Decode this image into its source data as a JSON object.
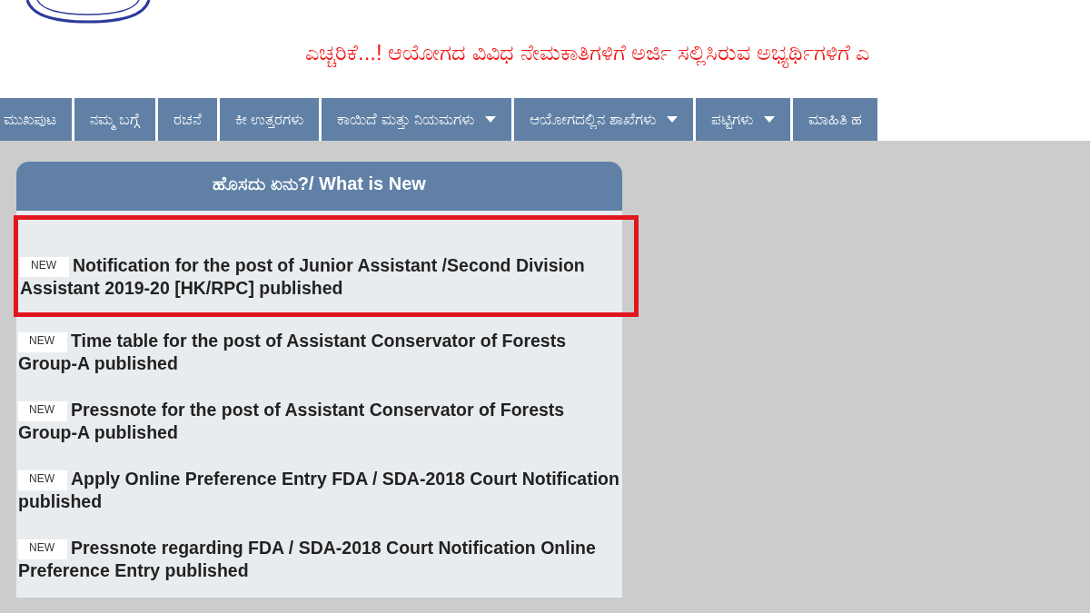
{
  "header": {
    "warning": "ಎಚ್ಚರಿಕೆ...! ಆಯೋಗದ ವಿವಿಧ ನೇಮಕಾತಿಗಳಿಗೆ ಅರ್ಜಿ ಸಲ್ಲಿಸಿರುವ ಅಭ್ಯರ್ಥಿಗಳಿಗೆ ಎ"
  },
  "nav": [
    {
      "label": "ಮುಖಪುಟ",
      "dropdown": false
    },
    {
      "label": "ನಮ್ಮ ಬಗ್ಗೆ",
      "dropdown": false
    },
    {
      "label": "ರಚನೆ",
      "dropdown": false
    },
    {
      "label": "ಕೀ ಉತ್ತರಗಳು",
      "dropdown": false
    },
    {
      "label": "ಕಾಯಿದೆ ಮತ್ತು ನಿಯಮಗಳು",
      "dropdown": true
    },
    {
      "label": "ಆಯೋಗದಲ್ಲಿನ ಶಾಖೆಗಳು",
      "dropdown": true
    },
    {
      "label": "ಪಟ್ಟಿಗಳು",
      "dropdown": true
    },
    {
      "label": "ಮಾಹಿತಿ ಹ",
      "dropdown": false
    }
  ],
  "news_panel": {
    "title": "ಹೊಸದು ಏನು?/ What is New",
    "items": [
      {
        "badge": "NEW",
        "text": "Notification for the post of Junior Assistant /Second Division Assistant 2019-20 [HK/RPC] published",
        "highlighted": true
      },
      {
        "badge": "NEW",
        "text": "Time table for the post of Assistant Conservator of Forests Group-A published",
        "highlighted": false
      },
      {
        "badge": "NEW",
        "text": "Pressnote for the post of Assistant Conservator of Forests Group-A published",
        "highlighted": false
      },
      {
        "badge": "NEW",
        "text": "Apply Online Preference Entry FDA / SDA-2018 Court Notification published",
        "highlighted": false
      },
      {
        "badge": "NEW",
        "text": "Pressnote regarding FDA / SDA-2018 Court Notification Online Preference Entry published",
        "highlighted": false
      }
    ]
  }
}
